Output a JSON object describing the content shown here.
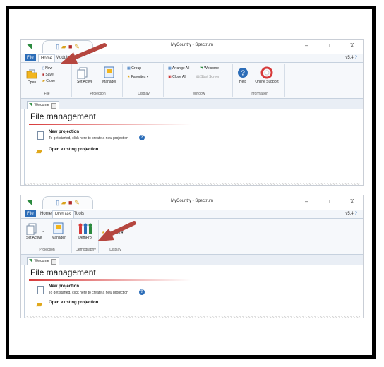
{
  "screen1": {
    "window_title": "MyCountry - Spectrum",
    "controls": {
      "minimize": "–",
      "maximize": "□",
      "close": "X"
    },
    "tabs": [
      "File",
      "Home",
      "Modules"
    ],
    "version": "v5.4",
    "ribbon": {
      "file_group": {
        "open": "Open",
        "new": "New",
        "save": "Save",
        "close": "Close",
        "label": "File"
      },
      "projection_group": {
        "set_active": "Set Active",
        "manager": "Manager",
        "label": "Projection"
      },
      "display_group": {
        "group": "Group",
        "favorites": "Favorites",
        "label": "Display"
      },
      "window_group": {
        "arrange_all": "Arrange All",
        "welcome": "Welcome",
        "close_all": "Close All",
        "start_screen": "Start Screen",
        "label": "Window"
      },
      "information_group": {
        "help": "Help",
        "online_support": "Online Support",
        "label": "Information"
      }
    },
    "doc_tab": "Welcome",
    "content": {
      "heading": "File management",
      "new_projection": {
        "title": "New projection",
        "desc": "To get started, click here to create a new projection"
      },
      "open_existing": {
        "title": "Open existing projection"
      }
    }
  },
  "screen2": {
    "window_title": "MyCountry - Spectrum",
    "controls": {
      "minimize": "–",
      "maximize": "□",
      "close": "X"
    },
    "tabs": [
      "File",
      "Home",
      "Modules",
      "Tools"
    ],
    "version": "v5.4",
    "ribbon": {
      "projection_group": {
        "set_active": "Set Active",
        "manager": "Manager",
        "label": "Projection"
      },
      "demography_group": {
        "dempro": "DemProj",
        "label": "Demography"
      },
      "display_group": {
        "favorites": "Favorites",
        "label": "Display"
      }
    },
    "doc_tab": "Welcome",
    "content": {
      "heading": "File management",
      "new_projection": {
        "title": "New projection",
        "desc": "To get started, click here to create a new projection"
      },
      "open_existing": {
        "title": "Open existing projection"
      }
    }
  },
  "colors": {
    "frame": "#000000",
    "file_tab": "#2c6db8",
    "accent_red": "#d73a3a",
    "arrow": "#b5463f"
  }
}
